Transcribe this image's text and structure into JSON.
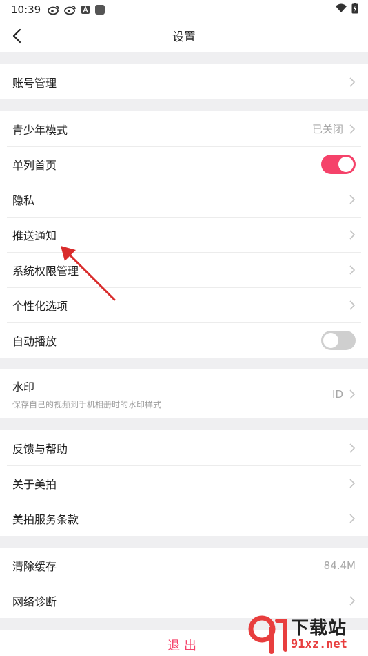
{
  "status_bar": {
    "time": "10:39"
  },
  "nav": {
    "title": "设置"
  },
  "groups": {
    "account": {
      "account_label": "账号管理"
    },
    "general": {
      "youth_label": "青少年模式",
      "youth_value": "已关闭",
      "single_column_label": "单列首页",
      "single_column_on": true,
      "privacy_label": "隐私",
      "push_label": "推送通知",
      "permission_label": "系统权限管理",
      "personal_label": "个性化选项",
      "autoplay_label": "自动播放",
      "autoplay_on": false
    },
    "watermark": {
      "label": "水印",
      "desc": "保存自己的视频到手机相册时的水印样式",
      "value": "ID"
    },
    "about": {
      "feedback_label": "反馈与帮助",
      "about_label": "关于美拍",
      "terms_label": "美拍服务条款"
    },
    "storage": {
      "cache_label": "清除缓存",
      "cache_value": "84.4M",
      "network_label": "网络诊断"
    }
  },
  "logout": {
    "label": "退出"
  },
  "site_watermark": {
    "title": "下载站",
    "url": "91xz.net"
  },
  "colors": {
    "accent": "#f5426a",
    "arrow": "#d92b2b"
  }
}
